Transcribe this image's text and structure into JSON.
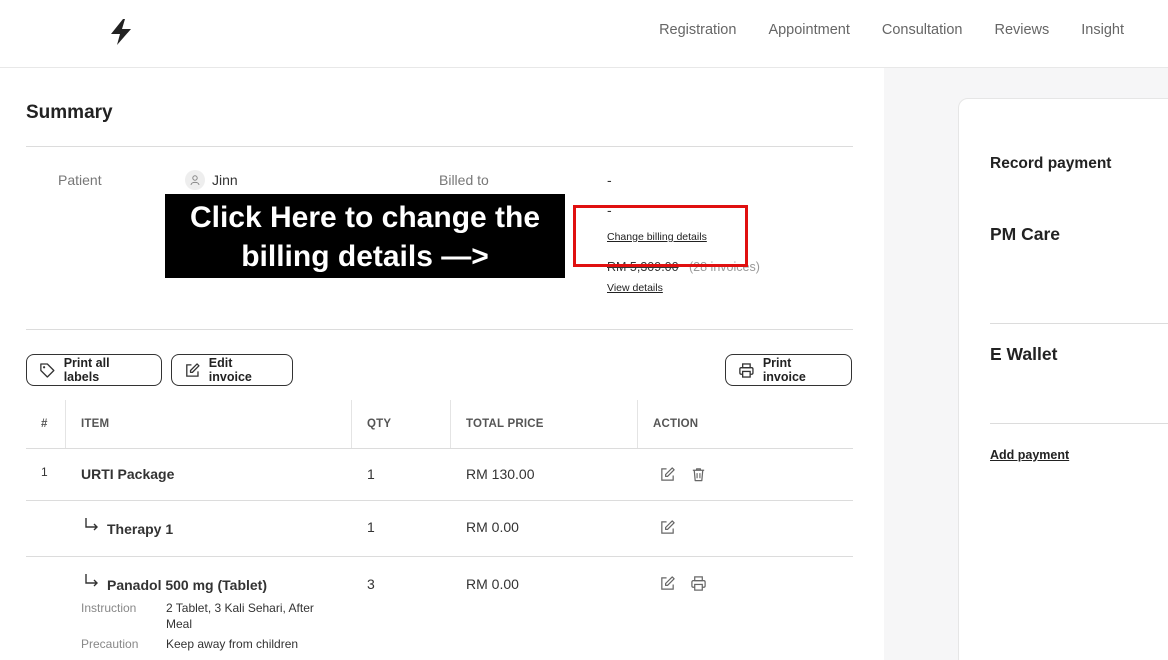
{
  "nav": {
    "items": [
      "Registration",
      "Appointment",
      "Consultation",
      "Reviews",
      "Insight"
    ]
  },
  "summary": {
    "title": "Summary",
    "patient_label": "Patient",
    "patient_name": "Jinn",
    "billed_to_label": "Billed to",
    "billed_to_value": "-",
    "billing_second_value": "-",
    "change_billing_link": "Change billing details",
    "outstanding_amount": "RM 5,309.00",
    "outstanding_count": "(28 invoices)",
    "view_details_link": "View details"
  },
  "annotation": {
    "line1": "Click Here to change the",
    "line2": "billing details —>"
  },
  "toolbar": {
    "print_labels": "Print all labels",
    "edit_invoice": "Edit invoice",
    "print_invoice": "Print invoice"
  },
  "table": {
    "headers": [
      "#",
      "ITEM",
      "QTY",
      "TOTAL PRICE",
      "ACTION"
    ],
    "rows": [
      {
        "num": "1",
        "item": "URTI Package",
        "qty": "1",
        "price": "RM 130.00"
      },
      {
        "num": "",
        "item": "Therapy 1",
        "qty": "1",
        "price": "RM 0.00"
      },
      {
        "num": "",
        "item": "Panadol 500 mg (Tablet)",
        "qty": "3",
        "price": "RM 0.00",
        "instruction_label": "Instruction",
        "instruction_l1": "2 Tablet, 3 Kali Sehari, After",
        "instruction_l2": "Meal",
        "precaution_label": "Precaution",
        "precaution": "Keep away from children"
      }
    ]
  },
  "record_payment": {
    "title": "Record payment",
    "methods": [
      "PM Care",
      "E Wallet"
    ],
    "add_payment": "Add payment"
  }
}
